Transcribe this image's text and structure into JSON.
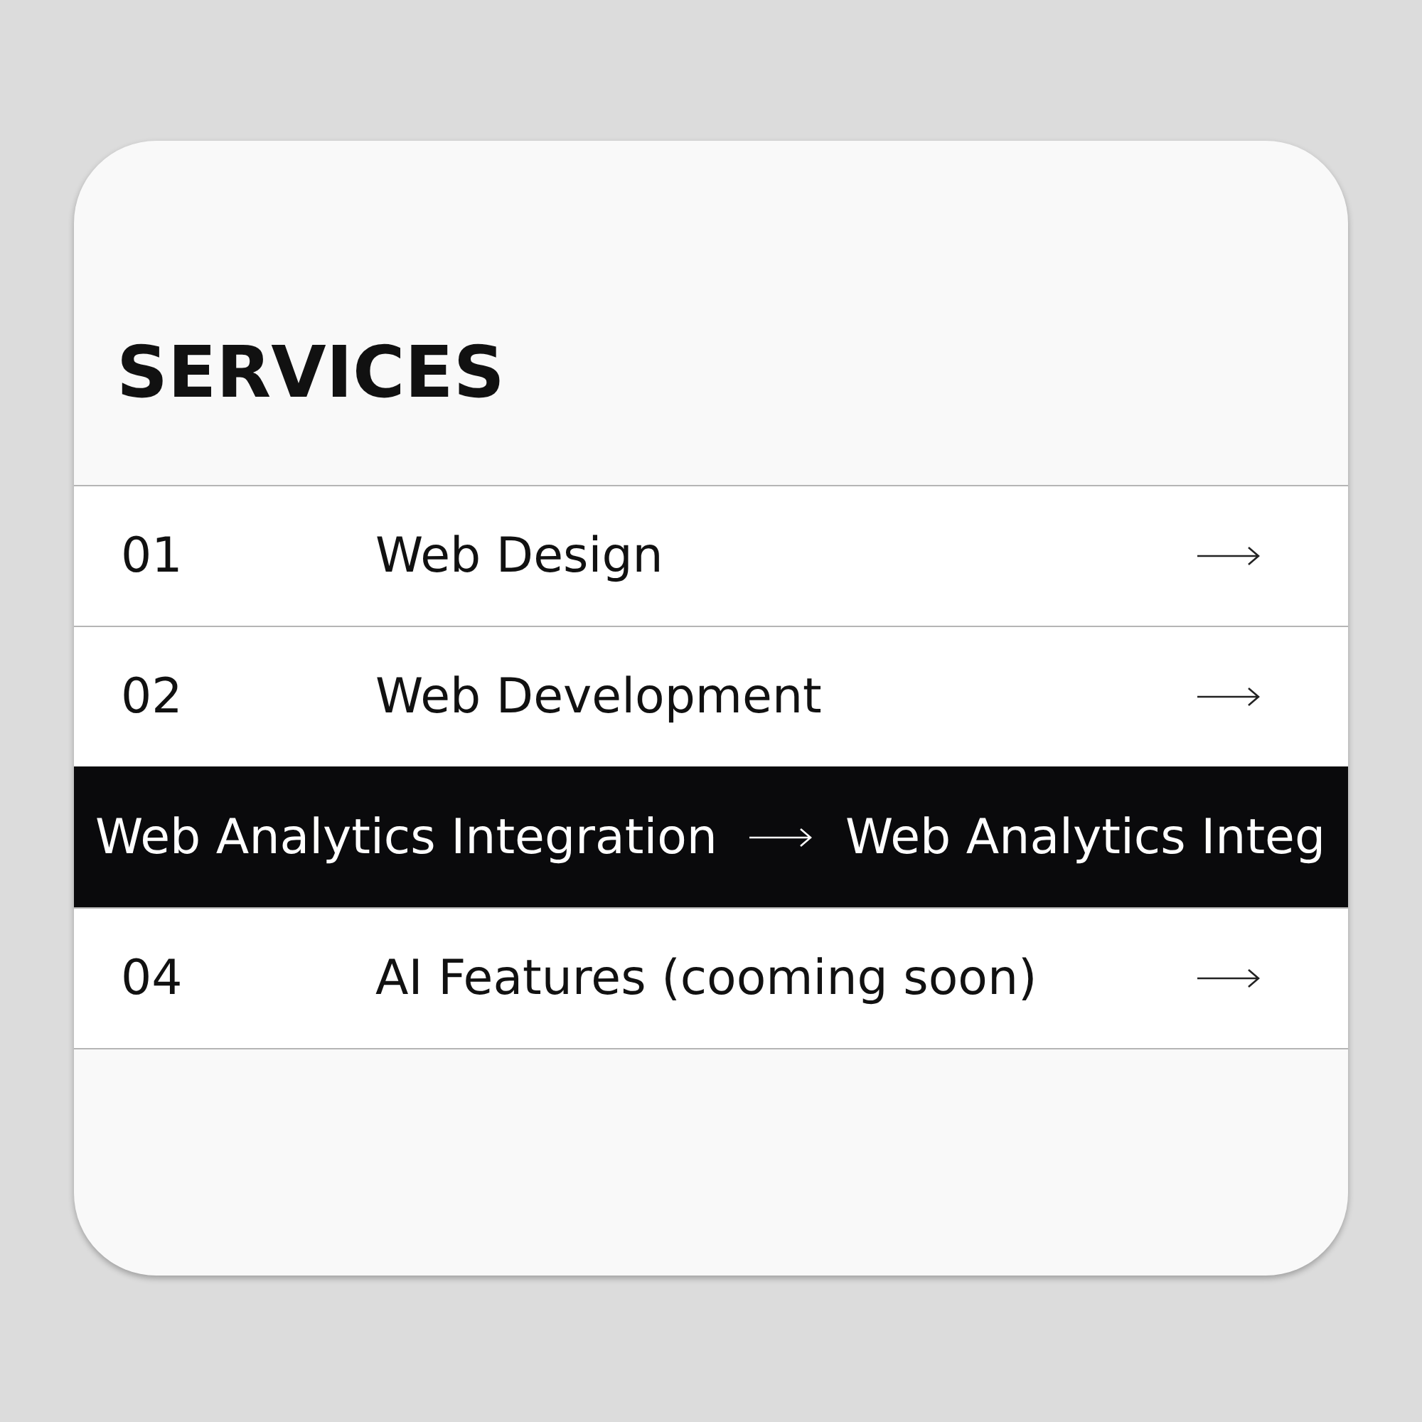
{
  "title": "SERVICES",
  "services": [
    {
      "kind": "row",
      "number": "01",
      "title": "Web Design"
    },
    {
      "kind": "row",
      "number": "02",
      "title": "Web Development"
    },
    {
      "kind": "marquee",
      "items": [
        "Web Analytics Integration",
        "Web Analytics Integ"
      ]
    },
    {
      "kind": "row",
      "number": "04",
      "title": "AI Features (cooming soon)"
    }
  ]
}
